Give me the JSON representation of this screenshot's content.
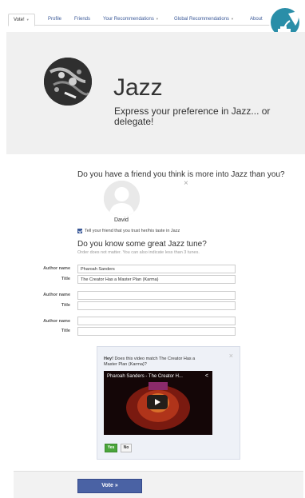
{
  "nav": {
    "items": [
      {
        "label": "Vote!",
        "has_caret": true,
        "active": true
      },
      {
        "label": "Profile"
      },
      {
        "label": "Friends"
      },
      {
        "label": "Your Recommendations",
        "has_caret": true
      },
      {
        "label": "Global Recommendations",
        "has_caret": true
      },
      {
        "label": "About"
      }
    ],
    "caret_glyph": "▼"
  },
  "logo": {
    "icon": "gramophone-icon",
    "color": "#2a8ea8"
  },
  "hero": {
    "title": "Jazz",
    "subtitle": "Express your preference in Jazz... or delegate!"
  },
  "friend": {
    "question": "Do you have a friend you think is more into Jazz than you?",
    "name": "David",
    "close_glyph": "×",
    "trust_label": "Tell your friend that you trust her/his taste in Jazz",
    "trust_checked": true
  },
  "tunes": {
    "question": "Do you know some great Jazz tune?",
    "hint": "Order does not matter. You can also indicate less than 3 tunes.",
    "author_label": "Author name",
    "title_label": "Title",
    "entries": [
      {
        "author": "Pharoah Sanders",
        "title": "The Creator Has a Master Plan (Karma)"
      },
      {
        "author": "",
        "title": ""
      },
      {
        "author": "",
        "title": ""
      }
    ]
  },
  "video": {
    "prompt_bold": "Hey!",
    "prompt_rest": " Does this video match The Creator Has a Master Plan (Karma)?",
    "player_title": "Pharoah Sanders - The Creator H...",
    "close_glyph": "×",
    "share_glyph": "<",
    "yes_label": "Yes",
    "no_label": "No"
  },
  "footer": {
    "vote_label": "Vote »"
  },
  "colors": {
    "accent": "#3b5998",
    "vote_button": "#4a62a4",
    "yes_button": "#4aa53a"
  }
}
